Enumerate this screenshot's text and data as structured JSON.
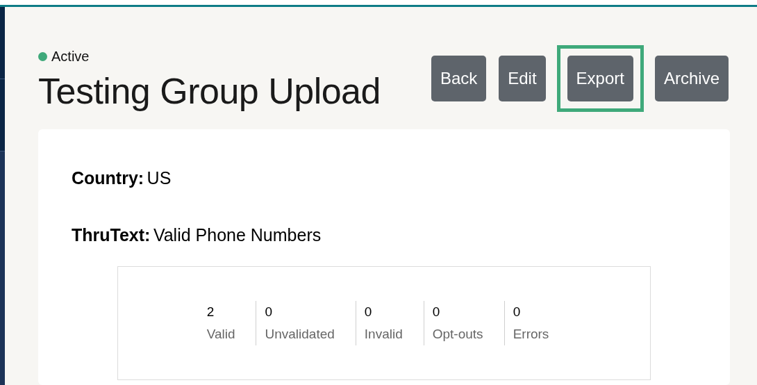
{
  "status": {
    "label": "Active",
    "color": "#3fa97a"
  },
  "title": "Testing Group Upload",
  "buttons": [
    {
      "label": "Back",
      "highlighted": false
    },
    {
      "label": "Edit",
      "highlighted": false
    },
    {
      "label": "Export",
      "highlighted": true
    },
    {
      "label": "Archive",
      "highlighted": false
    }
  ],
  "fields": [
    {
      "label": "Country:",
      "value": "US"
    },
    {
      "label": "ThruText:",
      "value": "Valid Phone Numbers"
    }
  ],
  "stats": [
    {
      "value": "2",
      "label": "Valid"
    },
    {
      "value": "0",
      "label": "Unvalidated"
    },
    {
      "value": "0",
      "label": "Invalid"
    },
    {
      "value": "0",
      "label": "Opt-outs"
    },
    {
      "value": "0",
      "label": "Errors"
    }
  ]
}
